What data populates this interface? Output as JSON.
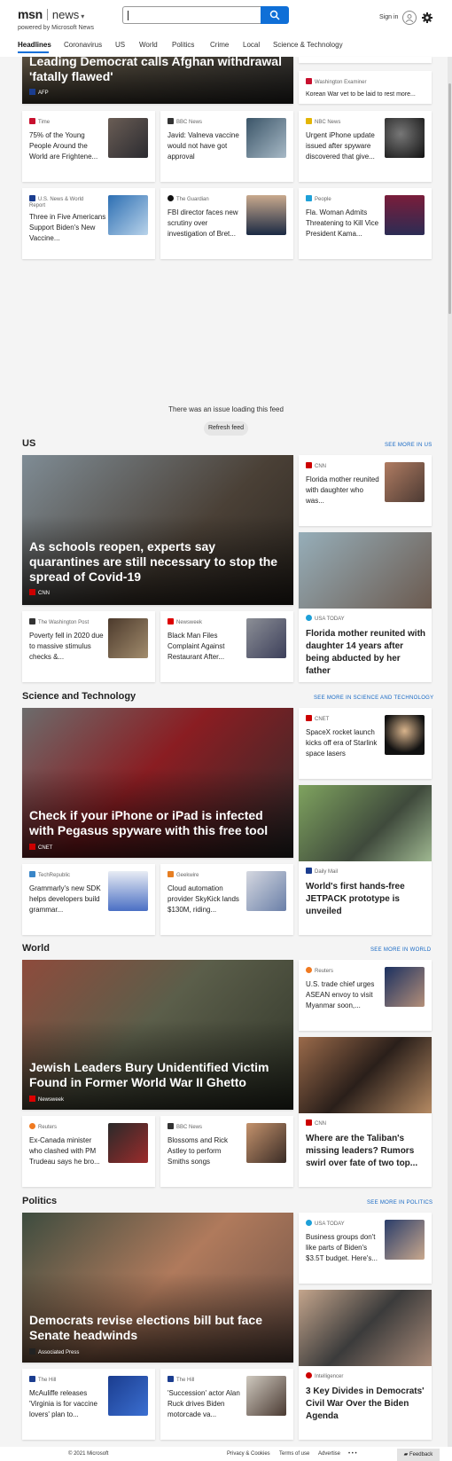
{
  "header": {
    "brand": "msn",
    "section": "news",
    "powered_by": "powered by Microsoft News",
    "search_value": "",
    "sign_in": "Sign in"
  },
  "nav": [
    "Headlines",
    "Coronavirus",
    "US",
    "World",
    "Politics",
    "Crime",
    "Local",
    "Science & Technology"
  ],
  "hero_top": {
    "title": "Leading Democrat calls Afghan withdrawal 'fatally flawed'",
    "source": "AFP"
  },
  "top_side": {
    "source": "Washington Examiner",
    "title": "Korean War vet to be laid to rest more..."
  },
  "headline_cards": [
    {
      "source": "Time",
      "title": "75% of the Young People Around the World are Frightene...",
      "color": "#c8102e"
    },
    {
      "source": "BBC News",
      "title": "Javid: Valneva vaccine would not have got approval",
      "color": "#333"
    },
    {
      "source": "NBC News",
      "title": "Urgent iPhone update issued after spyware discovered that give...",
      "color": "#e3b505"
    },
    {
      "source": "U.S. News & World Report",
      "title": "Three in Five Americans Support Biden's New Vaccine...",
      "color": "#1b3d8f"
    },
    {
      "source": "The Guardian",
      "title": "FBI director faces new scrutiny over investigation of Bret...",
      "color": "#111"
    },
    {
      "source": "People",
      "title": "Fla. Woman Admits Threatening to Kill Vice President Kama...",
      "color": "#1ea0d8"
    }
  ],
  "feed_error": {
    "message": "There was an issue loading this feed",
    "button": "Refresh feed"
  },
  "sections": [
    {
      "title": "US",
      "see_more": "SEE MORE IN US",
      "hero": {
        "title": "As schools reopen, experts say quarantines are still necessary to stop the spread of Covid-19",
        "source": "CNN"
      },
      "side_small": {
        "source": "CNN",
        "title": "Florida mother reunited with daughter who was..."
      },
      "side_tall": {
        "source": "USA TODAY",
        "title": "Florida mother reunited with daughter 14 years after being abducted by her father"
      },
      "bottom": [
        {
          "source": "The Washington Post",
          "title": "Poverty fell in 2020 due to massive stimulus checks &..."
        },
        {
          "source": "Newsweek",
          "title": "Black Man Files Complaint Against Restaurant After..."
        }
      ]
    },
    {
      "title": "Science and Technology",
      "see_more": "SEE MORE IN SCIENCE AND TECHNOLOGY",
      "hero": {
        "title": "Check if your iPhone or iPad is infected with Pegasus spyware with this free tool",
        "source": "CNET"
      },
      "side_small": {
        "source": "CNET",
        "title": "SpaceX rocket launch kicks off era of Starlink space lasers"
      },
      "side_tall": {
        "source": "Daily Mail",
        "title": "World's first hands-free JETPACK prototype is unveiled"
      },
      "bottom": [
        {
          "source": "TechRepublic",
          "title": "Grammarly's new SDK helps developers build grammar..."
        },
        {
          "source": "Geekwire",
          "title": "Cloud automation provider SkyKick lands $130M, riding..."
        }
      ]
    },
    {
      "title": "World",
      "see_more": "SEE MORE IN WORLD",
      "hero": {
        "title": "Jewish Leaders Bury Unidentified Victim Found in Former World War II Ghetto",
        "source": "Newsweek"
      },
      "side_small": {
        "source": "Reuters",
        "title": "U.S. trade chief urges ASEAN envoy to visit Myanmar soon,..."
      },
      "side_tall": {
        "source": "CNN",
        "title": "Where are the Taliban's missing leaders? Rumors swirl over fate of two top..."
      },
      "bottom": [
        {
          "source": "Reuters",
          "title": "Ex-Canada minister who clashed with PM Trudeau says he bro..."
        },
        {
          "source": "BBC News",
          "title": "Blossoms and Rick Astley to perform Smiths songs"
        }
      ]
    },
    {
      "title": "Politics",
      "see_more": "SEE MORE IN POLITICS",
      "hero": {
        "title": "Democrats revise elections bill but face Senate headwinds",
        "source": "Associated Press"
      },
      "side_small": {
        "source": "USA TODAY",
        "title": "Business groups don't like parts of Biden's $3.5T budget. Here's..."
      },
      "side_tall": {
        "source": "Intelligencer",
        "title": "3 Key Divides in Democrats' Civil War Over the Biden Agenda"
      },
      "bottom": [
        {
          "source": "The Hill",
          "title": "McAuliffe releases 'Virginia is for vaccine lovers' plan to..."
        },
        {
          "source": "The Hill",
          "title": "'Succession' actor Alan Ruck drives Biden motorcade va..."
        }
      ]
    }
  ],
  "footer": {
    "copyright": "© 2021 Microsoft",
    "links": [
      "Privacy & Cookies",
      "Terms of use",
      "Advertise"
    ],
    "more": "• • •",
    "feedback": "Feedback"
  }
}
